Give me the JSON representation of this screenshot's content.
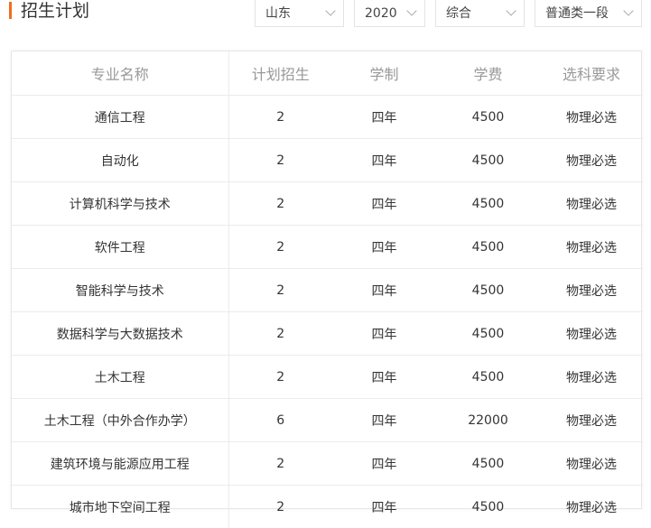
{
  "header": {
    "title": "招生计划"
  },
  "filters": [
    {
      "value": "山东"
    },
    {
      "value": "2020"
    },
    {
      "value": "综合"
    },
    {
      "value": "普通类一段"
    }
  ],
  "table": {
    "columns": [
      "专业名称",
      "计划招生",
      "学制",
      "学费",
      "选科要求"
    ],
    "rows": [
      [
        "通信工程",
        "2",
        "四年",
        "4500",
        "物理必选"
      ],
      [
        "自动化",
        "2",
        "四年",
        "4500",
        "物理必选"
      ],
      [
        "计算机科学与技术",
        "2",
        "四年",
        "4500",
        "物理必选"
      ],
      [
        "软件工程",
        "2",
        "四年",
        "4500",
        "物理必选"
      ],
      [
        "智能科学与技术",
        "2",
        "四年",
        "4500",
        "物理必选"
      ],
      [
        "数据科学与大数据技术",
        "2",
        "四年",
        "4500",
        "物理必选"
      ],
      [
        "土木工程",
        "2",
        "四年",
        "4500",
        "物理必选"
      ],
      [
        "土木工程（中外合作办学）",
        "6",
        "四年",
        "22000",
        "物理必选"
      ],
      [
        "建筑环境与能源应用工程",
        "2",
        "四年",
        "4500",
        "物理必选"
      ],
      [
        "城市地下空间工程",
        "2",
        "四年",
        "4500",
        "物理必选"
      ]
    ]
  },
  "colors": {
    "accent": "#f26d1f"
  }
}
